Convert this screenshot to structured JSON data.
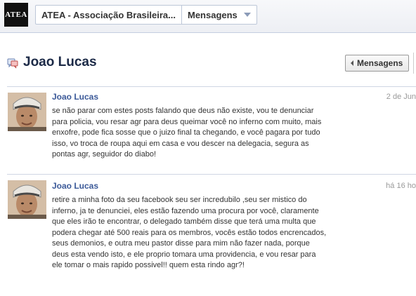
{
  "topbar": {
    "logo_text": "ATEA",
    "group_label": "ATEA - Associação Brasileira...",
    "section_label": "Mensagens"
  },
  "header": {
    "title": "Joao Lucas",
    "back_label": "Mensagens"
  },
  "messages": [
    {
      "author": "Joao Lucas",
      "time": "2 de Jun",
      "body": "se não parar com estes posts falando que deus não existe, vou te denunciar para policia, vou resar agr para deus queimar você no inferno com muito, mais enxofre, pode fica sosse que o juizo final ta chegando, e você pagara por tudo isso, vo troca de roupa aqui em casa e vou descer na delegacia, segura as pontas agr, seguidor do diabo!"
    },
    {
      "author": "Joao Lucas",
      "time": "há 16 ho",
      "body": "retire a minha foto da seu facebook seu ser incredubilo ,seu ser mistico do inferno, ja te denunciei, eles estão fazendo uma procura por você, claramente que eles irão te encontrar, o delegado também disse que terá uma multa que podera chegar até 500 reais para os membros, vocês estão todos encrencados, seus demonios, e outra meu pastor disse para mim não fazer nada, porque deus esta vendo isto, e ele proprio tomara uma providencia, e vou resar para ele tomar o mais rapido possivel!! quem esta rindo agr?!"
    }
  ]
}
